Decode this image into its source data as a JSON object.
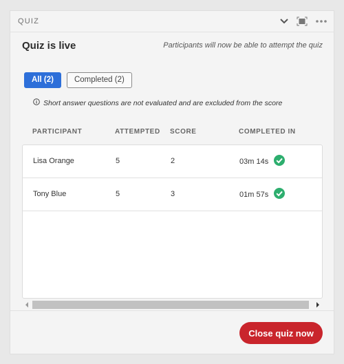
{
  "panel": {
    "title": "QUIZ",
    "icons": [
      "chevron-down-icon",
      "fullscreen-icon",
      "more-icon"
    ]
  },
  "subhead": {
    "status": "Quiz is live",
    "note": "Participants will now be able to attempt the quiz"
  },
  "filters": [
    {
      "label": "All (2)",
      "active": true
    },
    {
      "label": "Completed (2)",
      "active": false
    }
  ],
  "info": {
    "icon": "info-icon",
    "text": "Short answer questions are not evaluated and are excluded from the score"
  },
  "table": {
    "columns": [
      "PARTICIPANT",
      "ATTEMPTED",
      "SCORE",
      "COMPLETED IN"
    ],
    "rows": [
      {
        "participant": "Lisa Orange",
        "attempted": "5",
        "score": "2",
        "completed_in": "03m 14s",
        "status_icon": "check-circle-icon"
      },
      {
        "participant": "Tony Blue",
        "attempted": "5",
        "score": "3",
        "completed_in": "01m 57s",
        "status_icon": "check-circle-icon"
      }
    ]
  },
  "colors": {
    "accent": "#2d6fd9",
    "danger": "#c9252c",
    "success": "#2dae6e"
  },
  "footer": {
    "close_label": "Close quiz now"
  }
}
